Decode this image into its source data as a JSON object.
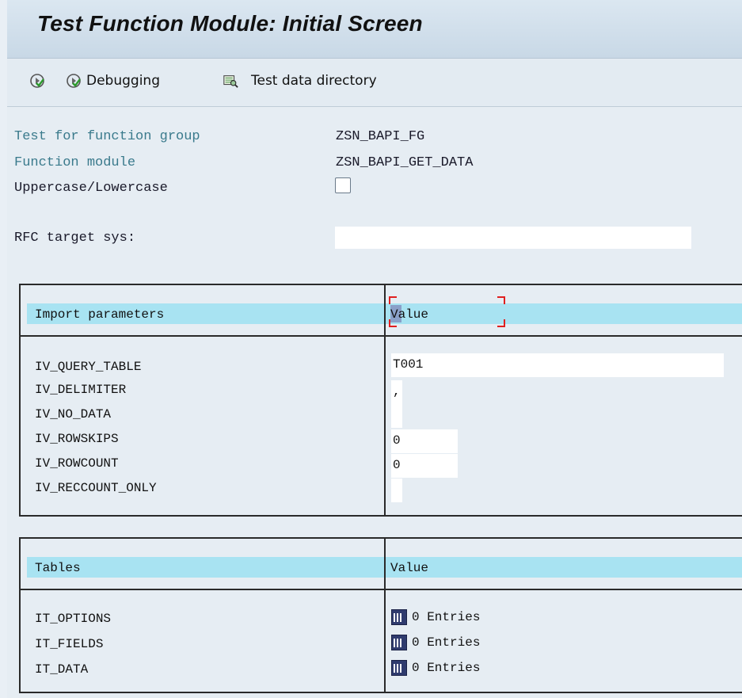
{
  "window": {
    "title": "Test Function Module: Initial Screen"
  },
  "toolbar": {
    "execute_icon": "execute-icon",
    "debugging_label": "Debugging",
    "test_data_dir_label": "Test data directory"
  },
  "form": {
    "group_label": "Test for function group",
    "group_value": "ZSN_BAPI_FG",
    "module_label": "Function module",
    "module_value": "ZSN_BAPI_GET_DATA",
    "case_label": "Uppercase/Lowercase",
    "case_checked": false,
    "rfc_label": "RFC target sys:",
    "rfc_value": ""
  },
  "import_params": {
    "header_left": "Import parameters",
    "header_right": "Value",
    "rows": [
      {
        "name": "IV_QUERY_TABLE",
        "value": "T001"
      },
      {
        "name": "IV_DELIMITER",
        "value": ","
      },
      {
        "name": "IV_NO_DATA",
        "value": ""
      },
      {
        "name": "IV_ROWSKIPS",
        "value": "0"
      },
      {
        "name": "IV_ROWCOUNT",
        "value": "0"
      },
      {
        "name": "IV_RECCOUNT_ONLY",
        "value": ""
      }
    ]
  },
  "tables": {
    "header_left": "Tables",
    "header_right": "Value",
    "rows": [
      {
        "name": "IT_OPTIONS",
        "value": "0 Entries"
      },
      {
        "name": "IT_FIELDS",
        "value": "0 Entries"
      },
      {
        "name": "IT_DATA",
        "value": "0 Entries"
      }
    ]
  },
  "colors": {
    "header_band": "#a8e3f2",
    "label_teal": "#3a7a8c",
    "focus_corner": "#e02020"
  }
}
